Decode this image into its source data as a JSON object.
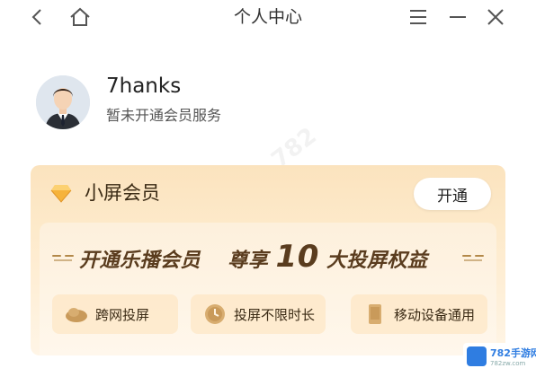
{
  "titlebar": {
    "title": "个人中心",
    "icons": [
      "back-arrow-icon",
      "home-icon",
      "menu-icon",
      "minimize-icon",
      "close-icon"
    ]
  },
  "profile": {
    "username": "7hanks",
    "member_status": "暂未开通会员服务"
  },
  "membership_card": {
    "title": "小屏会员",
    "open_button": "开通",
    "slogan_part1": "开通乐播会员",
    "slogan_part2": "尊享",
    "slogan_number": "10",
    "slogan_part3": "大投屏权益",
    "benefits": [
      {
        "label": "跨网投屏",
        "icon": "cloud-network-icon"
      },
      {
        "label": "投屏不限时长",
        "icon": "clock-icon"
      },
      {
        "label": "移动设备通用",
        "icon": "mobile-device-icon"
      }
    ]
  },
  "watermark_logo": {
    "text": "782手游网",
    "sub": "782zw.com"
  },
  "colors": {
    "card_gold": "#fbe3be",
    "slogan_brown": "#5a3c1e",
    "brand_blue": "#2f7de1"
  }
}
